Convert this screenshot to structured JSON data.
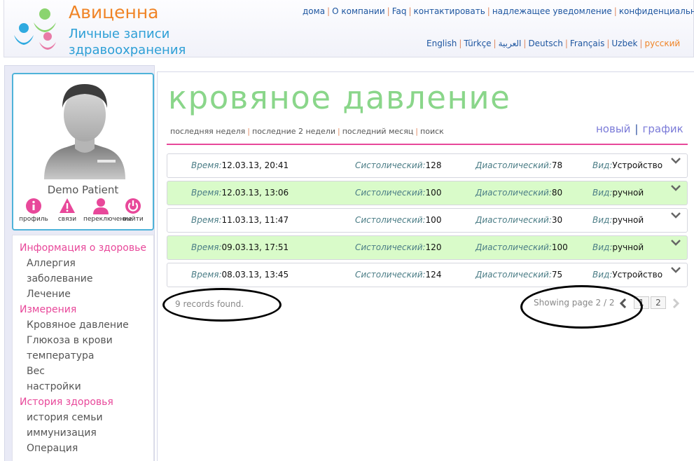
{
  "brand": {
    "name": "Авиценна",
    "subtitle_line1": "Личные записи",
    "subtitle_line2": "здравоохранения"
  },
  "top_nav": [
    "дома",
    "О компании",
    "Faq",
    "контактировать",
    "надлежащее уведомление",
    "конфиденциальность"
  ],
  "languages": {
    "items": [
      "English",
      "Türkçe",
      "العربية",
      "Deutsch",
      "Français",
      "Uzbek",
      "русский"
    ],
    "active": "русский"
  },
  "profile": {
    "name": "Demo Patient",
    "actions": [
      {
        "label": "профиль",
        "icon": "info-icon"
      },
      {
        "label": "связи",
        "icon": "warning-icon"
      },
      {
        "label": "переключение",
        "icon": "person-icon"
      },
      {
        "label": "выйти",
        "icon": "power-icon"
      }
    ]
  },
  "menu": [
    {
      "category": "Информация о здоровье",
      "items": [
        "Аллергия",
        "заболевание",
        "Лечение"
      ]
    },
    {
      "category": "Измерения",
      "items": [
        "Кровяное давление",
        "Глюкоза в крови",
        "температура",
        "Вес",
        "настройки"
      ]
    },
    {
      "category": "История здоровья",
      "items": [
        "история семьи",
        "иммунизация",
        "Операция"
      ]
    }
  ],
  "page": {
    "title": "кровяное давление",
    "filters": [
      "последняя неделя",
      "последние 2 недели",
      "последний месяц",
      "поиск"
    ],
    "new_label": "новый",
    "chart_label": "график"
  },
  "labels": {
    "time": "Время:",
    "systolic": "Систолический:",
    "diastolic": "Диастолический:",
    "type": "Вид:"
  },
  "records": [
    {
      "time": "12.03.13, 20:41",
      "systolic": "128",
      "diastolic": "78",
      "type": "Устройство"
    },
    {
      "time": "12.03.13, 13:06",
      "systolic": "100",
      "diastolic": "80",
      "type": "ручной"
    },
    {
      "time": "11.03.13, 11:47",
      "systolic": "100",
      "diastolic": "30",
      "type": "ручной"
    },
    {
      "time": "09.03.13, 17:51",
      "systolic": "120",
      "diastolic": "100",
      "type": "ручной"
    },
    {
      "time": "08.03.13, 13:45",
      "systolic": "124",
      "diastolic": "75",
      "type": "Устройство"
    }
  ],
  "footer": {
    "records_found": "9 records found.",
    "showing_page": "Showing page 2 / 2",
    "pages": [
      "1",
      "2"
    ]
  }
}
